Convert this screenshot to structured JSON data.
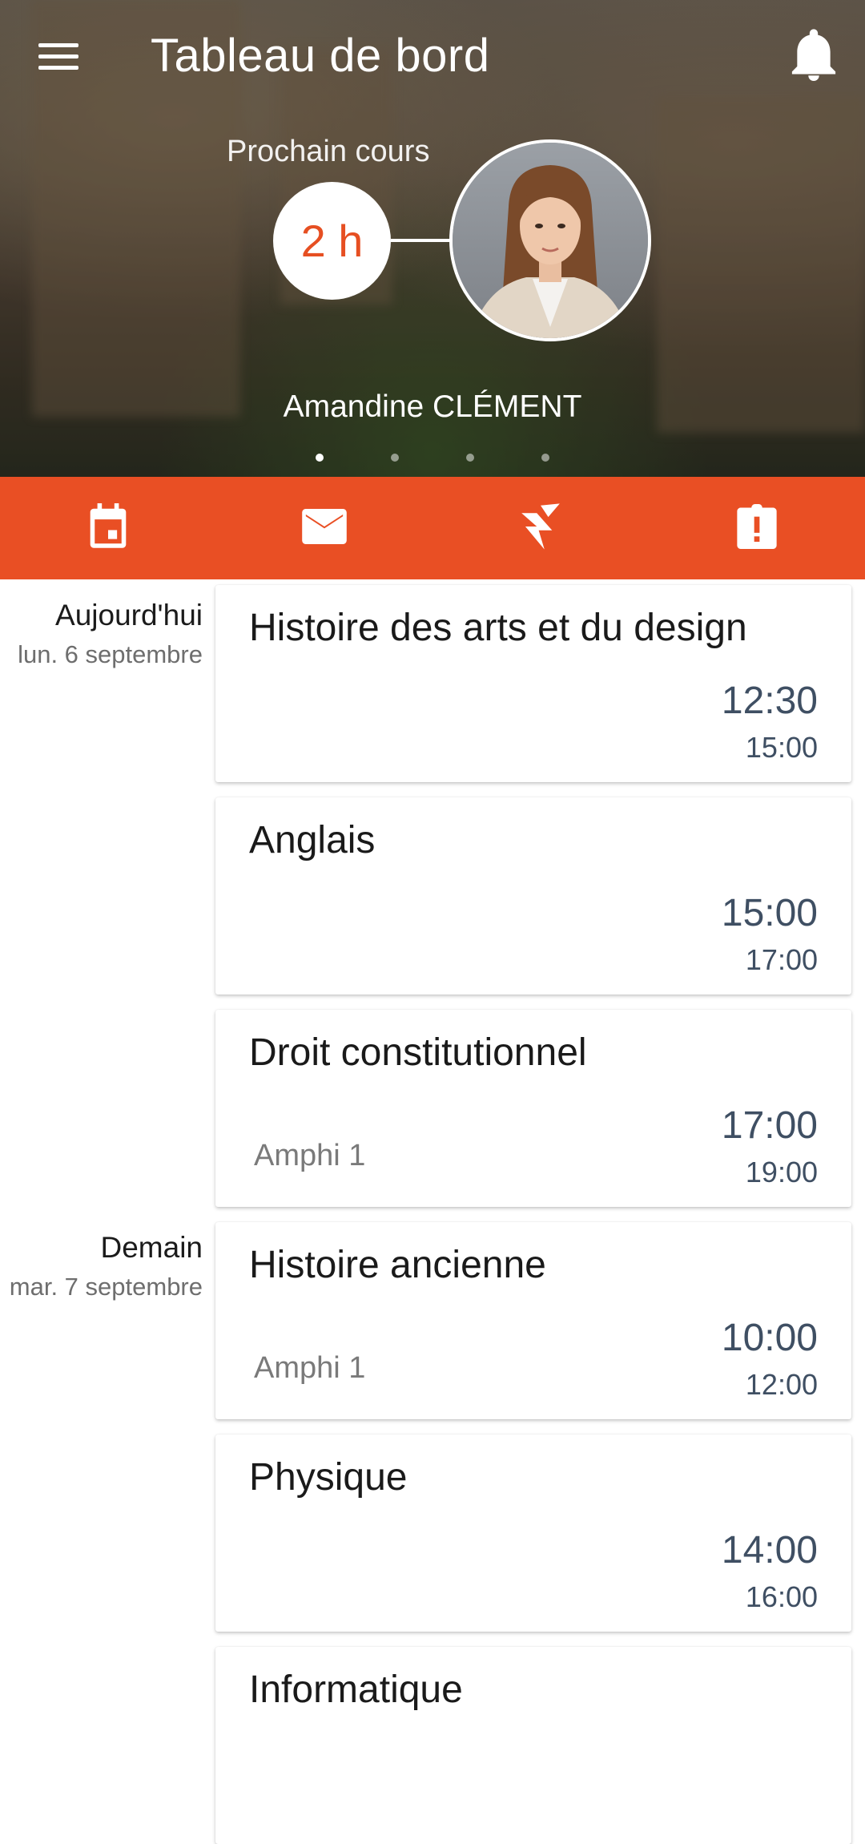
{
  "header": {
    "title": "Tableau de bord",
    "next_course_label": "Prochain cours",
    "countdown": "2 h",
    "teacher_name": "Amandine CLÉMENT",
    "carousel": {
      "pages": 4,
      "active_index": 0
    }
  },
  "toolbar": {
    "items": [
      {
        "icon": "calendar-icon"
      },
      {
        "icon": "mail-icon"
      },
      {
        "icon": "grades-icon"
      },
      {
        "icon": "clipboard-alert-icon"
      }
    ]
  },
  "days": [
    {
      "name": "Aujourd'hui",
      "date": "lun. 6 septembre"
    },
    {
      "name": "Demain",
      "date": "mar. 7 septembre"
    }
  ],
  "courses": [
    {
      "title": "Histoire des arts et du design",
      "room": "",
      "start": "12:30",
      "end": "15:00"
    },
    {
      "title": "Anglais",
      "room": "",
      "start": "15:00",
      "end": "17:00"
    },
    {
      "title": "Droit constitutionnel",
      "room": "Amphi 1",
      "start": "17:00",
      "end": "19:00"
    },
    {
      "title": "Histoire ancienne",
      "room": "Amphi 1",
      "start": "10:00",
      "end": "12:00"
    },
    {
      "title": "Physique",
      "room": "",
      "start": "14:00",
      "end": "16:00"
    },
    {
      "title": "Informatique",
      "room": "",
      "start": "",
      "end": ""
    }
  ],
  "colors": {
    "accent": "#e94f24",
    "time_text": "#3f4f63"
  }
}
